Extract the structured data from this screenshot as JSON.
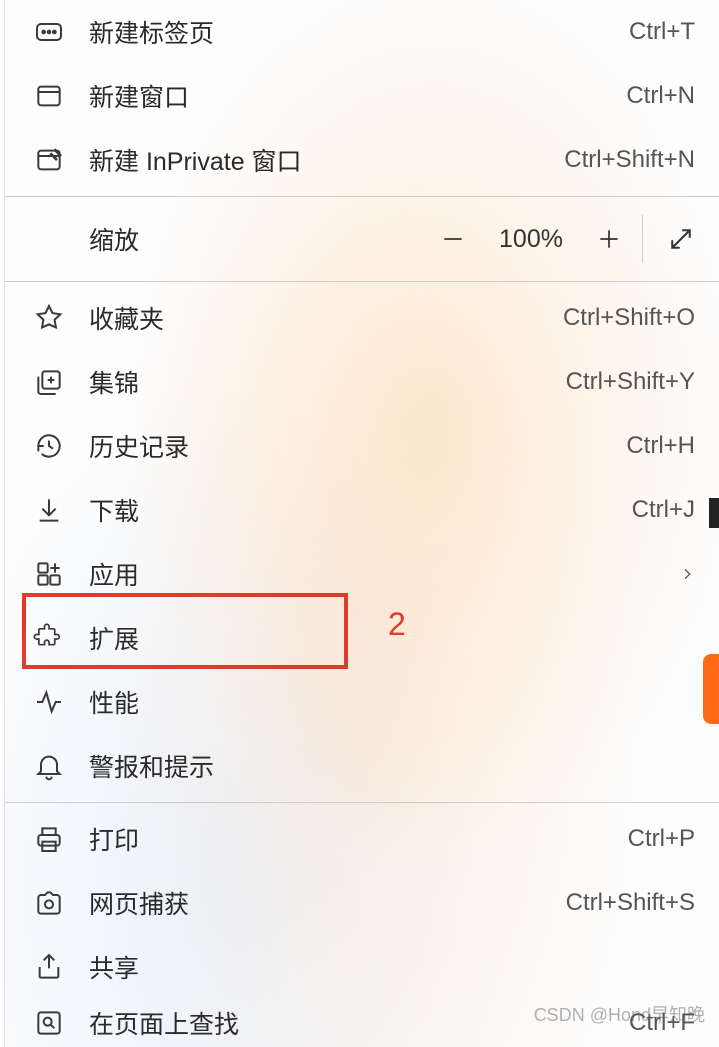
{
  "menu": {
    "group1": [
      {
        "id": "new-tab",
        "label": "新建标签页",
        "shortcut": "Ctrl+T",
        "icon": "tab-plus-icon"
      },
      {
        "id": "new-window",
        "label": "新建窗口",
        "shortcut": "Ctrl+N",
        "icon": "window-icon"
      },
      {
        "id": "new-inprivate",
        "label": "新建 InPrivate 窗口",
        "shortcut": "Ctrl+Shift+N",
        "icon": "inprivate-icon"
      }
    ],
    "zoom": {
      "label": "缩放",
      "value": "100%"
    },
    "group2": [
      {
        "id": "favorites",
        "label": "收藏夹",
        "shortcut": "Ctrl+Shift+O",
        "icon": "star-icon"
      },
      {
        "id": "collections",
        "label": "集锦",
        "shortcut": "Ctrl+Shift+Y",
        "icon": "collections-icon"
      },
      {
        "id": "history",
        "label": "历史记录",
        "shortcut": "Ctrl+H",
        "icon": "history-icon"
      },
      {
        "id": "downloads",
        "label": "下载",
        "shortcut": "Ctrl+J",
        "icon": "download-icon"
      },
      {
        "id": "apps",
        "label": "应用",
        "shortcut": "",
        "icon": "apps-icon",
        "submenu": true
      },
      {
        "id": "extensions",
        "label": "扩展",
        "shortcut": "",
        "icon": "extension-icon"
      },
      {
        "id": "performance",
        "label": "性能",
        "shortcut": "",
        "icon": "performance-icon"
      },
      {
        "id": "alerts",
        "label": "警报和提示",
        "shortcut": "",
        "icon": "bell-icon"
      }
    ],
    "group3": [
      {
        "id": "print",
        "label": "打印",
        "shortcut": "Ctrl+P",
        "icon": "print-icon"
      },
      {
        "id": "capture",
        "label": "网页捕获",
        "shortcut": "Ctrl+Shift+S",
        "icon": "capture-icon"
      },
      {
        "id": "share",
        "label": "共享",
        "shortcut": "",
        "icon": "share-icon"
      },
      {
        "id": "find",
        "label": "在页面上查找",
        "shortcut": "Ctrl+F",
        "icon": "find-icon"
      }
    ]
  },
  "annotation": {
    "number": "2"
  },
  "watermark": "CSDN @Hond早知晚"
}
